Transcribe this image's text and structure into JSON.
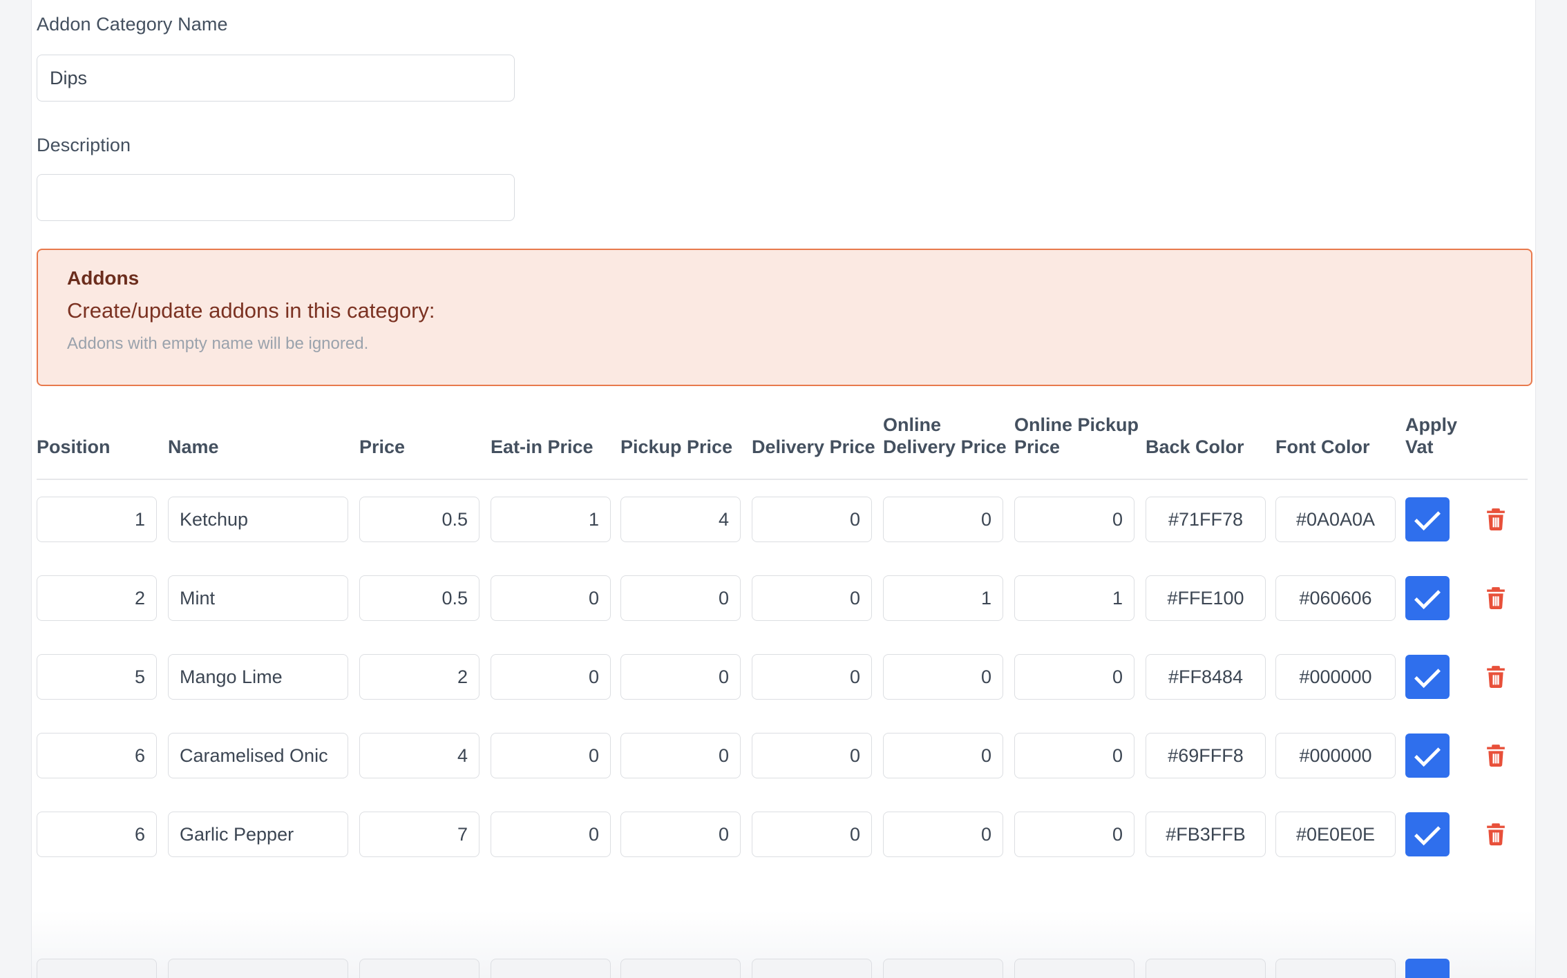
{
  "form": {
    "name_label": "Addon Category Name",
    "name_value": "Dips",
    "name_placeholder": "",
    "description_label": "Description",
    "description_value": "",
    "description_placeholder": ""
  },
  "alert": {
    "title": "Addons",
    "subtitle": "Create/update addons in this category:",
    "note": "Addons with empty name will be ignored.",
    "bg_color": "#FBE9E2",
    "border_color": "#E8794C",
    "title_color": "#6B2D1D"
  },
  "table": {
    "headers": [
      "Position",
      "Name",
      "Price",
      "Eat-in Price",
      "Pickup Price",
      "Delivery Price",
      "Online Delivery Price",
      "Online Pickup Price",
      "Back Color",
      "Font Color",
      "Apply Vat",
      ""
    ],
    "accent_checked_color": "#2F6FED",
    "delete_icon_color": "#E8503A",
    "rows": [
      {
        "position": "1",
        "name": "Ketchup",
        "price": "0.5",
        "eat_in_price": "1",
        "pickup_price": "4",
        "delivery_price": "0",
        "online_delivery_price": "0",
        "online_pickup_price": "0",
        "back_color": "#71FF78",
        "font_color": "#0A0A0A",
        "apply_vat": true,
        "delete_icon": "trash-icon"
      },
      {
        "position": "2",
        "name": "Mint",
        "price": "0.5",
        "eat_in_price": "0",
        "pickup_price": "0",
        "delivery_price": "0",
        "online_delivery_price": "1",
        "online_pickup_price": "1",
        "back_color": "#FFE100",
        "font_color": "#060606",
        "apply_vat": true,
        "delete_icon": "trash-icon"
      },
      {
        "position": "5",
        "name": "Mango Lime",
        "price": "2",
        "eat_in_price": "0",
        "pickup_price": "0",
        "delivery_price": "0",
        "online_delivery_price": "0",
        "online_pickup_price": "0",
        "back_color": "#FF8484",
        "font_color": "#000000",
        "apply_vat": true,
        "delete_icon": "trash-icon"
      },
      {
        "position": "6",
        "name": "Caramelised Onic",
        "price": "4",
        "eat_in_price": "0",
        "pickup_price": "0",
        "delivery_price": "0",
        "online_delivery_price": "0",
        "online_pickup_price": "0",
        "back_color": "#69FFF8",
        "font_color": "#000000",
        "apply_vat": true,
        "delete_icon": "trash-icon"
      },
      {
        "position": "6",
        "name": "Garlic Pepper",
        "price": "7",
        "eat_in_price": "0",
        "pickup_price": "0",
        "delivery_price": "0",
        "online_delivery_price": "0",
        "online_pickup_price": "0",
        "back_color": "#FB3FFB",
        "font_color": "#0E0E0E",
        "apply_vat": true,
        "delete_icon": "trash-icon"
      }
    ]
  }
}
